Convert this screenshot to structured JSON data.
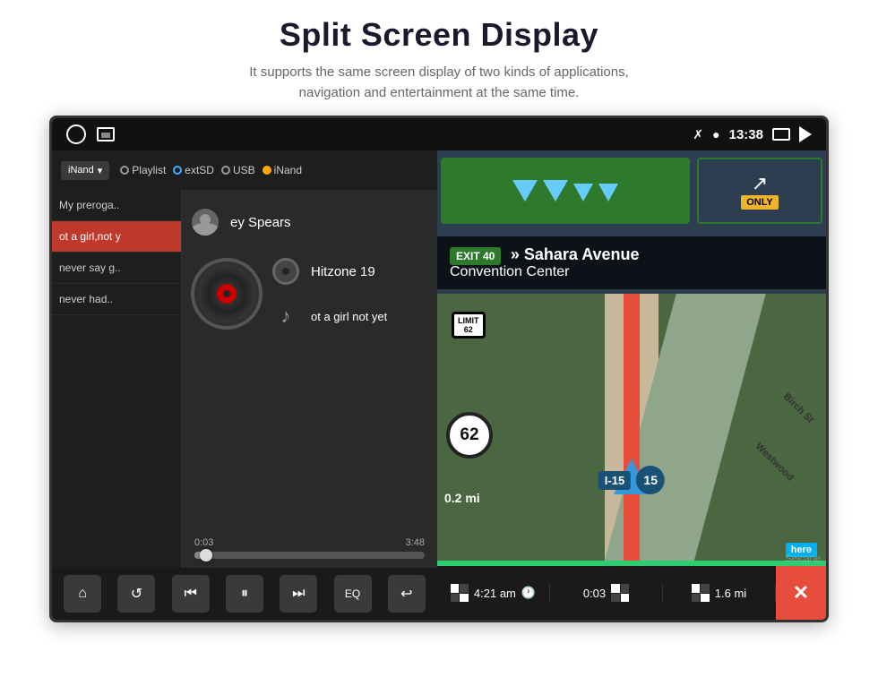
{
  "page": {
    "title": "Split Screen Display",
    "subtitle_line1": "It supports the same screen display of two kinds of applications,",
    "subtitle_line2": "navigation and entertainment at the same time."
  },
  "status_bar": {
    "time": "13:38",
    "icons": [
      "bluetooth",
      "location",
      "screen",
      "back"
    ]
  },
  "music_player": {
    "source_label": "iNand",
    "source_tabs": [
      "Playlist",
      "extSD",
      "USB",
      "iNand"
    ],
    "playlist": [
      {
        "text": "My preroga..",
        "active": false
      },
      {
        "text": "ot a girl,not y",
        "active": true
      },
      {
        "text": "never say g..",
        "active": false
      },
      {
        "text": "never had..",
        "active": false
      }
    ],
    "track": {
      "artist": "ey Spears",
      "album": "Hitzone 19",
      "title": "ot a girl not yet"
    },
    "progress": {
      "current": "0:03",
      "total": "3:48",
      "percent": 5
    },
    "controls": [
      "home",
      "repeat",
      "prev",
      "pause",
      "next",
      "eq",
      "back"
    ]
  },
  "navigation": {
    "exit_number": "EXIT 40",
    "exit_destination": "Sahara Avenue",
    "exit_sub": "Convention Center",
    "distance_label": "0.2 mi",
    "speed_limit": "62",
    "highway": "I-15",
    "highway_number": "15",
    "bottom_items": [
      {
        "label": "4:21 am",
        "type": "time"
      },
      {
        "label": "0:03",
        "type": "duration"
      },
      {
        "label": "1.6 mi",
        "type": "distance"
      }
    ]
  }
}
